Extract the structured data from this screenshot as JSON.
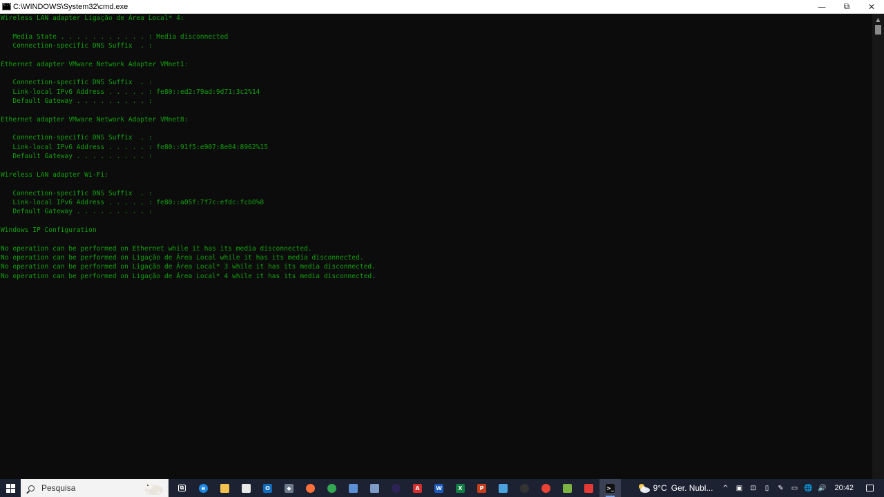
{
  "window": {
    "title": "C:\\WINDOWS\\System32\\cmd.exe",
    "controls": {
      "minimize": "—",
      "maximize": "⧉",
      "close": "✕"
    }
  },
  "console": {
    "text_color": "#13a10e",
    "background": "#0c0c0c",
    "lines": [
      "Wireless LAN adapter Ligação de Área Local* 4:",
      "",
      "   Media State . . . . . . . . . . . : Media disconnected",
      "   Connection-specific DNS Suffix  . :",
      "",
      "Ethernet adapter VMware Network Adapter VMnet1:",
      "",
      "   Connection-specific DNS Suffix  . :",
      "   Link-local IPv6 Address . . . . . : fe80::ed2:79ad:9d71:3c2%14",
      "   Default Gateway . . . . . . . . . :",
      "",
      "Ethernet adapter VMware Network Adapter VMnet8:",
      "",
      "   Connection-specific DNS Suffix  . :",
      "   Link-local IPv6 Address . . . . . : fe80::91f5:e907:8e04:8962%15",
      "   Default Gateway . . . . . . . . . :",
      "",
      "Wireless LAN adapter Wi-Fi:",
      "",
      "   Connection-specific DNS Suffix  . :",
      "   Link-local IPv6 Address . . . . . : fe80::a05f:7f7c:efdc:fcb0%8",
      "   Default Gateway . . . . . . . . . :",
      "",
      "Windows IP Configuration",
      "",
      "No operation can be performed on Ethernet while it has its media disconnected.",
      "No operation can be performed on Ligação de Área Local while it has its media disconnected.",
      "No operation can be performed on Ligação de Área Local* 3 while it has its media disconnected.",
      "No operation can be performed on Ligação de Área Local* 4 while it has its media disconnected."
    ]
  },
  "taskbar": {
    "search_placeholder": "Pesquisa",
    "apps": [
      {
        "name": "task-view-icon",
        "label": "⧉",
        "color": "#1c2232"
      },
      {
        "name": "edge-icon",
        "label": "e",
        "color": "#1e88e5"
      },
      {
        "name": "file-explorer-icon",
        "label": "",
        "color": "#f2c14e"
      },
      {
        "name": "store-icon",
        "label": "",
        "color": "#e8e8e8"
      },
      {
        "name": "outlook-icon",
        "label": "O",
        "color": "#0f6cbd"
      },
      {
        "name": "git-icon",
        "label": "◆",
        "color": "#6c7a89"
      },
      {
        "name": "firefox-icon",
        "label": "",
        "color": "#ff7139"
      },
      {
        "name": "chrome-icon",
        "label": "",
        "color": "#34a853"
      },
      {
        "name": "app-icon-blue",
        "label": "",
        "color": "#5b8fd6"
      },
      {
        "name": "image-viewer-icon",
        "label": "",
        "color": "#7f9cc9"
      },
      {
        "name": "eclipse-icon",
        "label": "",
        "color": "#2c2255"
      },
      {
        "name": "acrobat-icon",
        "label": "A",
        "color": "#d32f2f"
      },
      {
        "name": "word-icon",
        "label": "W",
        "color": "#185abd"
      },
      {
        "name": "excel-icon",
        "label": "X",
        "color": "#107c41"
      },
      {
        "name": "powerpoint-icon",
        "label": "P",
        "color": "#c43e1c"
      },
      {
        "name": "feather-icon",
        "label": "",
        "color": "#4aa3df"
      },
      {
        "name": "obs-icon",
        "label": "",
        "color": "#333333"
      },
      {
        "name": "chrome-dev-icon",
        "label": "",
        "color": "#ea4335"
      },
      {
        "name": "notepad-plus-icon",
        "label": "",
        "color": "#7cb342"
      },
      {
        "name": "virtualbox-icon",
        "label": "",
        "color": "#e53935"
      },
      {
        "name": "cmd-icon",
        "label": ">_",
        "color": "#111111"
      }
    ],
    "weather": {
      "temp": "9°C",
      "desc": "Ger. Nubl..."
    },
    "tray_icons": [
      {
        "name": "chevron-up-icon",
        "label": "^"
      },
      {
        "name": "app-tray-icon-1",
        "label": "▣"
      },
      {
        "name": "app-tray-icon-2",
        "label": "⊡"
      },
      {
        "name": "app-tray-icon-3",
        "label": "▯"
      },
      {
        "name": "pen-icon",
        "label": "✎"
      },
      {
        "name": "battery-icon",
        "label": "▭"
      },
      {
        "name": "network-icon",
        "label": "🌐"
      },
      {
        "name": "volume-icon",
        "label": "🔊"
      }
    ],
    "clock": "20:42"
  }
}
